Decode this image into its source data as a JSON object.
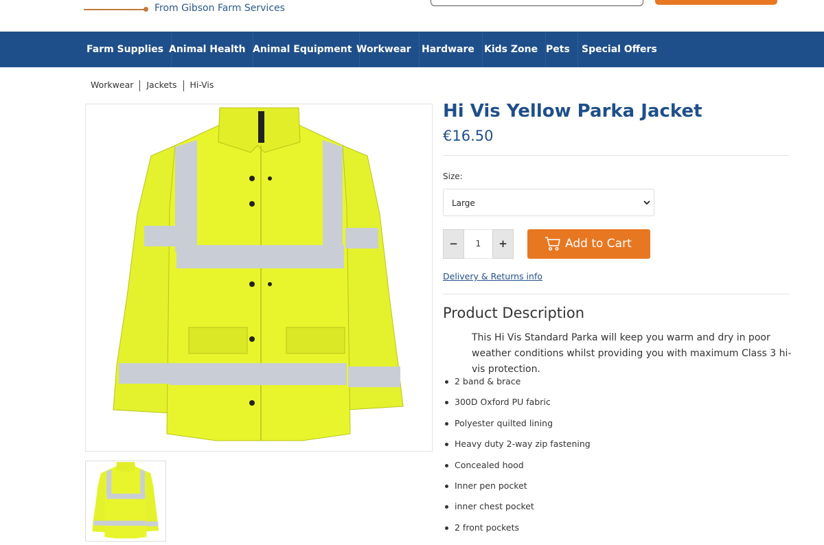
{
  "header": {
    "tagline": "From Gibson Farm Services"
  },
  "nav": {
    "items": [
      "Farm Supplies",
      "Animal Health",
      "Animal Equipment",
      "Workwear",
      "Hardware",
      "Kids Zone",
      "Pets",
      "Special Offers"
    ]
  },
  "breadcrumb": [
    "Workwear",
    "Jackets",
    "Hi-Vis"
  ],
  "product": {
    "title": "Hi Vis Yellow Parka Jacket",
    "price": "€16.50",
    "size_label": "Size:",
    "size_selected": "Large",
    "qty_minus": "−",
    "qty_value": "1",
    "qty_plus": "+",
    "add_to_cart": "Add to Cart",
    "delivery_link": "Delivery & Returns info",
    "description_heading": "Product Description",
    "description_text": "This Hi Vis Standard Parka will keep you warm and dry in poor weather conditions whilst providing you with maximum Class 3 hi-vis protection.",
    "features": [
      "2 band & brace",
      "300D Oxford PU fabric",
      "Polyester quilted lining",
      "Heavy duty 2-way zip fastening",
      "Concealed hood",
      "Inner pen pocket",
      "inner chest pocket",
      "2 front pockets"
    ]
  },
  "colors": {
    "brand_blue": "#1f4f8a",
    "accent_orange": "#e87722",
    "jacket_yellow": "#e6f52a"
  }
}
